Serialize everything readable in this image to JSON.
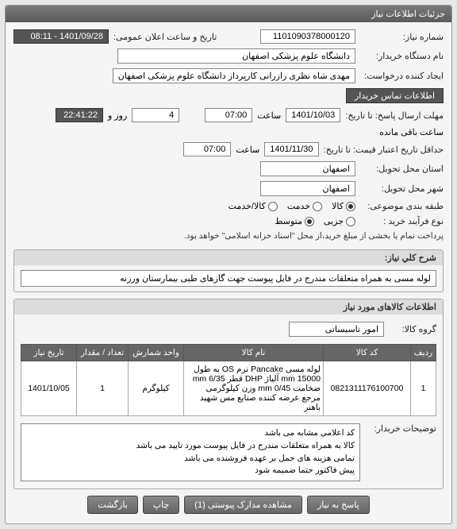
{
  "panel": {
    "title": "جزئیات اطلاعات نیاز"
  },
  "fields": {
    "need_no_lbl": "شماره نیاز:",
    "need_no": "1101090378000120",
    "announce_lbl": "تاریخ و ساعت اعلان عمومی:",
    "announce": "1401/09/28 - 08:11",
    "buyer_lbl": "نام دستگاه خریدار:",
    "buyer": "دانشگاه علوم پزشکی اصفهان",
    "creator_lbl": "ایجاد کننده درخواست:",
    "creator": "مهدی شاه نظری زازرانی کارپرداز دانشگاه علوم پزشکی اصفهان",
    "contact_btn": "اطلاعات تماس خریدار",
    "deadline_lbl": "مهلت ارسال پاسخ: تا تاریخ:",
    "deadline_date": "1401/10/03",
    "time_lbl": "ساعت",
    "deadline_time": "07:00",
    "days_lbl": "روز و",
    "days": "4",
    "remain_lbl": "ساعت باقی مانده",
    "remain_time": "22:41:22",
    "validity_lbl": "حداقل تاریخ اعتبار قیمت: تا تاریخ:",
    "validity_date": "1401/11/30",
    "validity_time": "07:00",
    "province_lbl": "استان محل تحویل:",
    "province": "اصفهان",
    "city_lbl": "شهر محل تحویل:",
    "city": "اصفهان",
    "category_lbl": "طبقه بندی موضوعی:",
    "cat_goods": "کالا",
    "cat_service": "خدمت",
    "cat_both": "کالا/خدمت",
    "process_lbl": "نوع فرآیند خرید :",
    "proc_low": "جزیی",
    "proc_mid": "متوسط",
    "payment_note": "پرداخت تمام یا بخشی از مبلغ خرید،از محل \"اسناد خزانه اسلامی\" خواهد بود."
  },
  "summary": {
    "header": "شرح کلي نیاز:",
    "text": "لوله مسی به همراه متعلقات مندرج در فایل پیوست جهت گازهای طبی بیمارستان ورزنه"
  },
  "items_section": {
    "header": "اطلاعات کالاهای مورد نیاز",
    "group_lbl": "گروه کالا:",
    "group": "امور تاسیساتی"
  },
  "table": {
    "headers": [
      "ردیف",
      "کد کالا",
      "نام کالا",
      "واحد شمارش",
      "تعداد / مقدار",
      "تاریخ نیاز"
    ],
    "rows": [
      {
        "idx": "1",
        "code": "0821311176100700",
        "name": "لوله مسی Pancake نرم OS به طول 15000 mm آلیاژ DHP قطر mm 6/35 ضخامت 0/45 mm وزن کیلوگرمی مرجع عرضه کننده صنایع مس شهید باهنر",
        "unit": "کیلوگرم",
        "qty": "1",
        "date": "1401/10/05"
      }
    ]
  },
  "buyer_notes": {
    "lbl": "توضیحات خریدار:",
    "text": "کد اعلامی مشابه می باشد\nکالا به همراه متعلقات مندرج در فایل پیوست مورد تایید می باشد\nتمامی هزینه های حمل بر عهده فروشنده می باشد\nپیش فاکتور حتما ضمیمه شود"
  },
  "buttons": {
    "reply": "پاسخ به نیاز",
    "attachments": "مشاهده مدارک پیوستی (1)",
    "print": "چاپ",
    "back": "بازگشت"
  }
}
